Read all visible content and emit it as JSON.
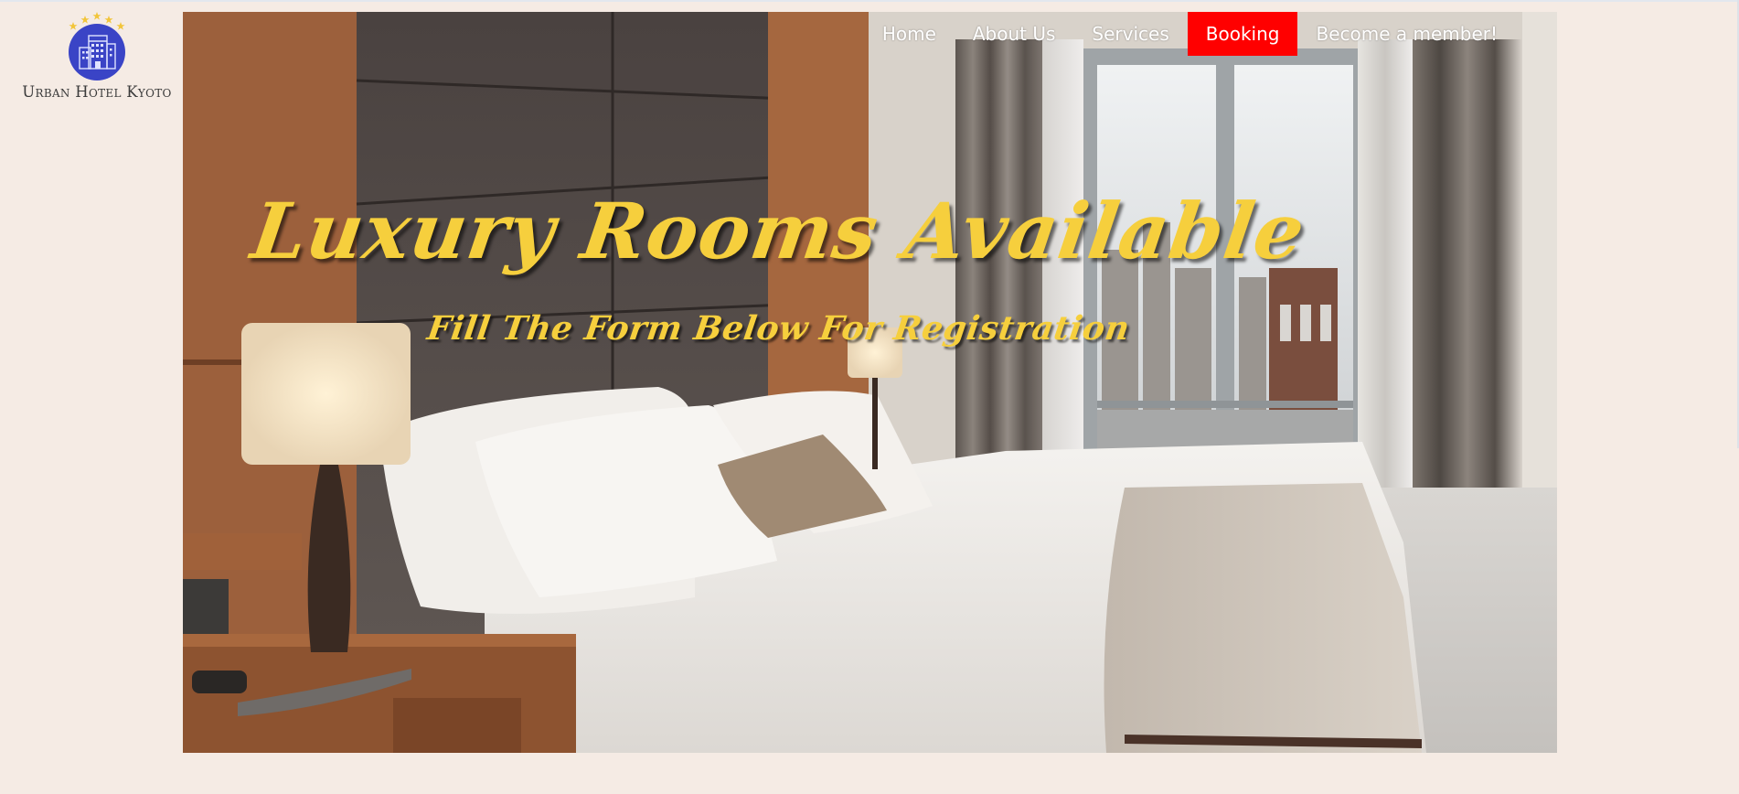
{
  "brand": {
    "name": "Urban Hotel Kyoto",
    "logo_icon": "hotel-building-icon",
    "logo_circle_color": "#3a44c6",
    "star_color": "#f2c53a",
    "star_count": 5
  },
  "nav": {
    "items": [
      {
        "label": "Home",
        "active": false
      },
      {
        "label": "About Us",
        "active": false
      },
      {
        "label": "Services",
        "active": false
      },
      {
        "label": "Booking",
        "active": true
      },
      {
        "label": "Become a member!",
        "active": false
      }
    ],
    "active_color": "#ff0000",
    "text_color": "#ffffff"
  },
  "hero": {
    "image": "hotel-bedroom-photo",
    "headline": "Luxury Rooms Available",
    "subheadline": "Fill The Form Below For Registration",
    "text_color": "#f6cf3d"
  },
  "colors": {
    "page_background": "#f5ebe4"
  }
}
